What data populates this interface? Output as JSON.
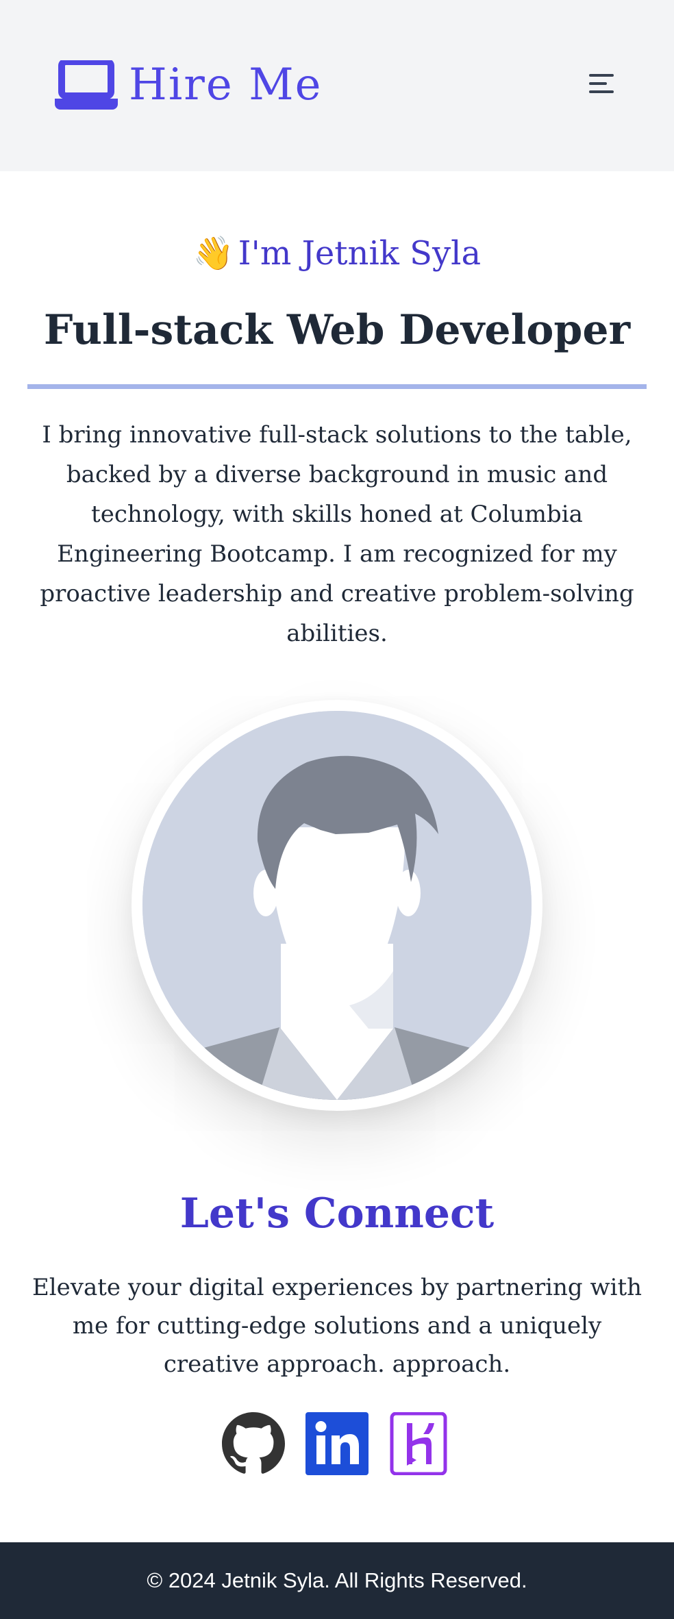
{
  "header": {
    "brand_text": "Hire Me",
    "brand_icon": "laptop-icon",
    "menu_icon": "menu-icon"
  },
  "hero": {
    "wave_emoji": "👋",
    "greeting": "I'm Jetnik Syla",
    "role": "Full-stack Web Developer",
    "bio": "I bring innovative full-stack solutions to the table, backed by a diverse background in music and technology, with skills honed at Columbia Engineering Bootcamp. I am recognized for my proactive leadership and creative problem-solving abilities."
  },
  "profile": {
    "avatar_icon": "default-avatar-icon"
  },
  "connect": {
    "title": "Let's Connect",
    "text": "Elevate your digital experiences by partnering with me for cutting-edge solutions and a uniquely creative approach. approach."
  },
  "socials": [
    {
      "icon": "github-icon",
      "color": "#333333"
    },
    {
      "icon": "linkedin-icon",
      "color": "#1d4ed8"
    },
    {
      "icon": "heroku-icon",
      "color": "#9333ea"
    }
  ],
  "footer": {
    "copyright": "© 2024 Jetnik Syla. All Rights Reserved."
  },
  "colors": {
    "brand": "#4f46e5",
    "accent_heading": "#4338ca",
    "header_bg": "#f3f4f6",
    "divider": "#a4b4ea",
    "footer_bg": "#1f2937"
  }
}
